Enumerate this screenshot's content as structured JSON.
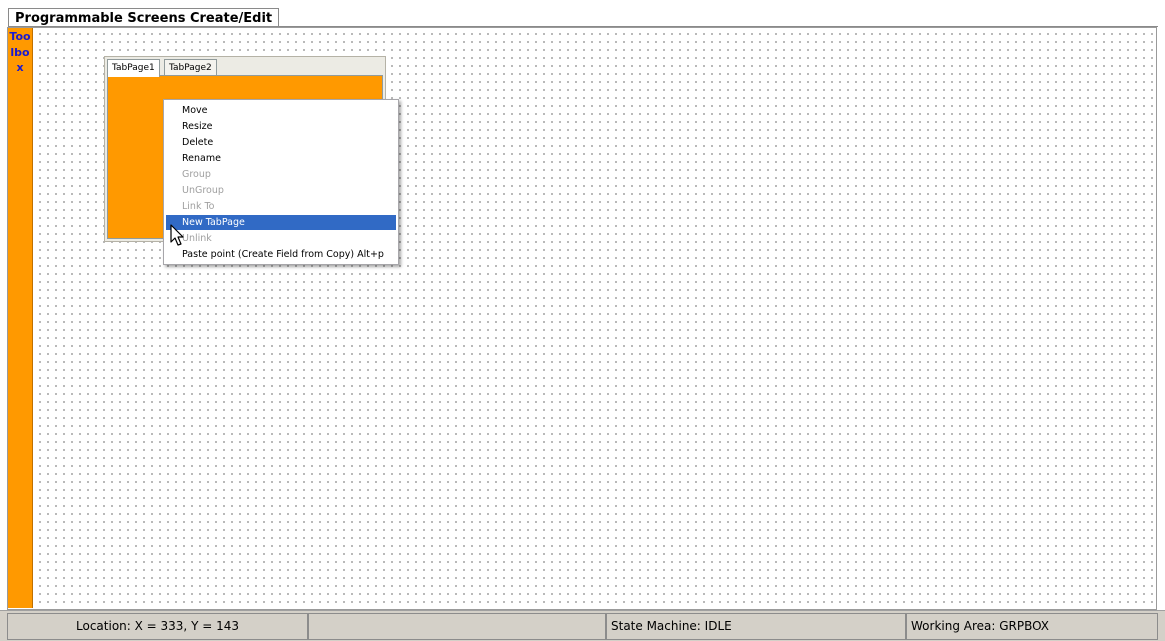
{
  "window": {
    "tab_title": "Programmable Screens Create/Edit"
  },
  "toolbox": {
    "label": "Toolbox",
    "background_color": "#ff9900",
    "text_color": "#1a1ad0"
  },
  "canvas": {
    "tab_control": {
      "tabs": [
        {
          "label": "TabPage1",
          "selected": true
        },
        {
          "label": "TabPage2",
          "selected": false
        }
      ],
      "page_color": "#ff9900"
    }
  },
  "context_menu": {
    "items": [
      {
        "label": "Move",
        "enabled": true
      },
      {
        "label": "Resize",
        "enabled": true
      },
      {
        "label": "Delete",
        "enabled": true
      },
      {
        "label": "Rename",
        "enabled": true
      },
      {
        "label": "Group",
        "enabled": false
      },
      {
        "label": "UnGroup",
        "enabled": false
      },
      {
        "label": "Link To",
        "enabled": false
      },
      {
        "label": "New TabPage",
        "enabled": true,
        "highlighted": true
      },
      {
        "label": "Unlink",
        "enabled": false
      },
      {
        "label": "Paste point (Create Field from Copy) Alt+p",
        "enabled": true
      }
    ],
    "highlight_color": "#316ac5"
  },
  "cursor": {
    "icon": "arrow-pointer-icon"
  },
  "status_bar": {
    "location": "Location: X = 333, Y = 143",
    "blank": "",
    "state_machine": "State Machine: IDLE",
    "working_area": "Working Area: GRPBOX"
  }
}
